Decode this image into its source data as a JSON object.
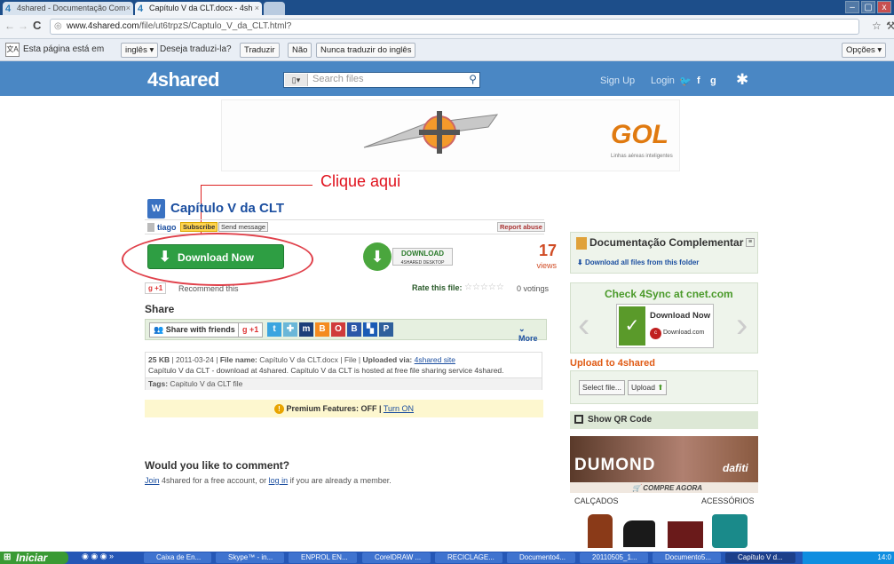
{
  "browser": {
    "tabs": [
      {
        "label": "4shared - Documentação Com"
      },
      {
        "label": "Capítulo V da CLT.docx - 4sh"
      }
    ],
    "url_host": "www.4shared.com",
    "url_path": "/file/ut6trpzS/Captulo_V_da_CLT.html?",
    "window_controls": {
      "minimize": "–",
      "maximize": "▢",
      "close": "x"
    }
  },
  "translate_bar": {
    "prefix": "Esta página está em",
    "language": "inglês",
    "question": "Deseja traduzi-la?",
    "translate": "Traduzir",
    "no": "Não",
    "never": "Nunca traduzir do inglês",
    "options": "Opções"
  },
  "site_nav": {
    "logo": "4shared",
    "search_placeholder": "Search files",
    "signup": "Sign Up",
    "login": "Login"
  },
  "callout": {
    "text": "Clique aqui"
  },
  "file": {
    "title": "Capítulo V da CLT",
    "owner": "tiago",
    "subscribe": "Subscribe",
    "send_message": "Send message",
    "report": "Report abuse",
    "download_now": "Download Now",
    "desktop_line1": "DOWNLOAD",
    "desktop_line2": "4SHARED DESKTOP",
    "views_count": "17",
    "views_label": "views",
    "plus_one": "+1",
    "recommend": "Recommend this",
    "rate_label": "Rate this file:",
    "votes": "0 votings",
    "share_heading": "Share",
    "share_friends": "Share with friends",
    "share_plus": "+1",
    "more": "More",
    "info_size": "25 KB",
    "info_date": "| 2011-03-24 |",
    "info_filename_label": "File name:",
    "info_filename": "Capítulo V da CLT.docx | File |",
    "info_uploaded_label": "Uploaded via:",
    "info_uploaded_link": "4shared site",
    "info_description": "Capítulo V da CLT - download at 4shared. Capítulo V da CLT is hosted at free file sharing service 4shared.",
    "info_tags_label": "Tags:",
    "info_tags": "Capitulo V da CLT  file",
    "premium_label": "Premium Features: OFF |",
    "premium_link": "Turn ON",
    "comment_heading": "Would you like to comment?",
    "comment_join": "Join",
    "comment_mid": "4shared for a free account, or",
    "comment_login": "log in",
    "comment_end": "if you are already a member."
  },
  "sidebar": {
    "folder_title": "Documentação Complementar",
    "download_all": "Download all files from this folder",
    "sync_title": "Check 4Sync at cnet.com",
    "sync_btn": "Download Now",
    "sync_sub": "Download.com",
    "upload_title": "Upload to 4shared",
    "select_file": "Select file...",
    "upload_btn": "Upload",
    "qr": "Show QR Code",
    "ad_brand": "DUMOND",
    "ad_partner": "dafiti",
    "ad_cta": "COMPRE AGORA",
    "ad_left": "CALÇADOS",
    "ad_right": "ACESSÓRIOS"
  },
  "banner": {
    "brand": "GOL",
    "tagline": "Linhas aéreas inteligentes"
  },
  "taskbar": {
    "start": "Iniciar",
    "items": [
      {
        "label": "Caixa de En..."
      },
      {
        "label": "Skype™ - in..."
      },
      {
        "label": "ENPROL EN..."
      },
      {
        "label": "CorelDRAW ..."
      },
      {
        "label": "RECICLAGE..."
      },
      {
        "label": "Documento4..."
      },
      {
        "label": "20110505_1..."
      },
      {
        "label": "Documento5..."
      },
      {
        "label": "Capítulo V d..."
      }
    ],
    "clock": "14:0"
  }
}
